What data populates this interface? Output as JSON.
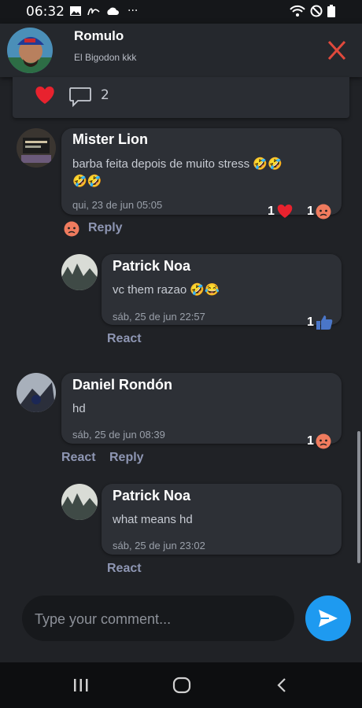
{
  "status": {
    "time": "06:32",
    "more": "···"
  },
  "header": {
    "name": "Romulo",
    "subtitle": "El Bigodon kkk"
  },
  "post": {
    "comment_count": "2"
  },
  "comments": [
    {
      "author": "Mister Lion",
      "text_line1": "barba feita depois de muito stress 🤣🤣",
      "text_line2": "🤣🤣",
      "time": "qui, 23 de jun 05:05",
      "reaction1_count": "1",
      "reaction2_count": "1",
      "reply_label": "Reply"
    },
    {
      "author": "Patrick Noa",
      "text": "vc them razao 🤣😂",
      "time": "sáb, 25 de jun 22:57",
      "reaction_count": "1",
      "react_label": "React"
    },
    {
      "author": "Daniel Rondón",
      "text": "hd",
      "time": "sáb, 25 de jun 08:39",
      "reaction_count": "1",
      "react_label": "React",
      "reply_label": "Reply"
    },
    {
      "author": "Patrick Noa",
      "text": "what means hd",
      "time": "sáb, 25 de jun 23:02",
      "react_label": "React"
    }
  ],
  "input": {
    "placeholder": "Type your comment..."
  },
  "colors": {
    "accent": "#1e9af0",
    "close": "#e0493c",
    "heart": "#e8222e",
    "action": "#8e96b3"
  }
}
